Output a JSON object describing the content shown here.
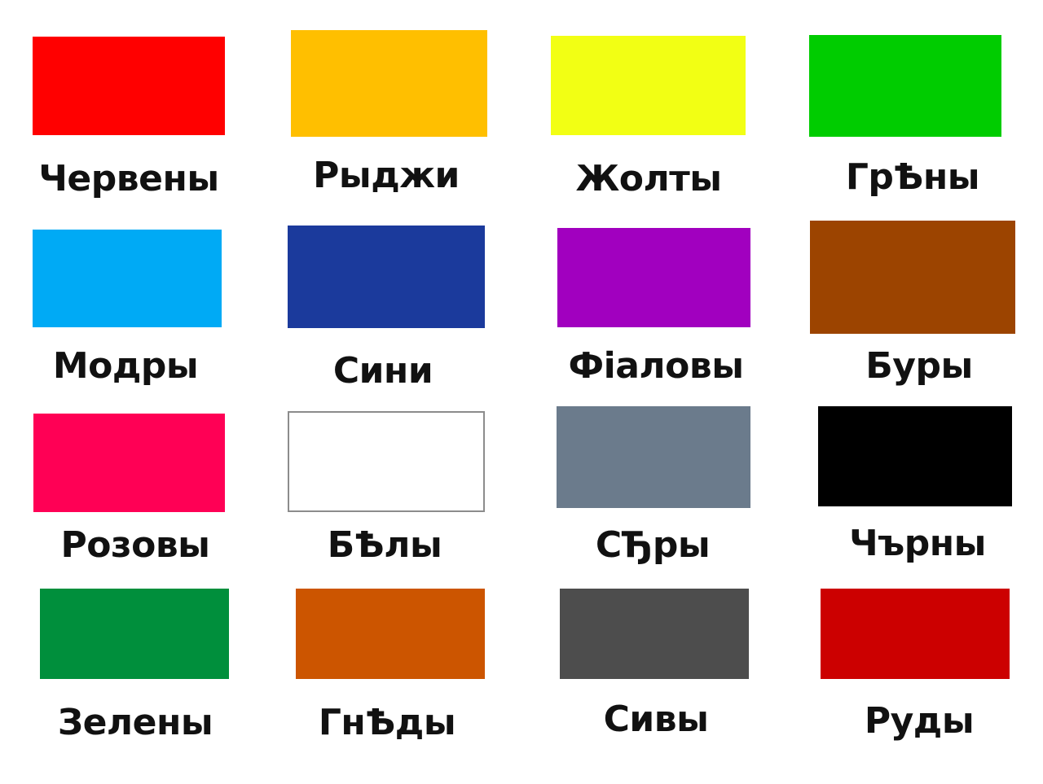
{
  "colors": [
    {
      "label": "Червены",
      "hex": "#ff0000"
    },
    {
      "label": "Рыджи",
      "hex": "#ffbf00"
    },
    {
      "label": "Жолты",
      "hex": "#f2ff14"
    },
    {
      "label": "ГрѢны",
      "hex": "#00cc00"
    },
    {
      "label": "Модры",
      "hex": "#00aaf5"
    },
    {
      "label": "Сини",
      "hex": "#1b3a9c"
    },
    {
      "label": "Фіаловы",
      "hex": "#a100bf"
    },
    {
      "label": "Буры",
      "hex": "#9c4400"
    },
    {
      "label": "Розовы",
      "hex": "#ff0055"
    },
    {
      "label": "БѢлы",
      "hex": "#ffffff"
    },
    {
      "label": "СЂры",
      "hex": "#6b7b8c"
    },
    {
      "label": "Чърны",
      "hex": "#000000"
    },
    {
      "label": "Зелены",
      "hex": "#008f3c"
    },
    {
      "label": "ГнѢды",
      "hex": "#cc5500"
    },
    {
      "label": "Сивы",
      "hex": "#4d4d4d"
    },
    {
      "label": "Руды",
      "hex": "#cc0000"
    }
  ]
}
